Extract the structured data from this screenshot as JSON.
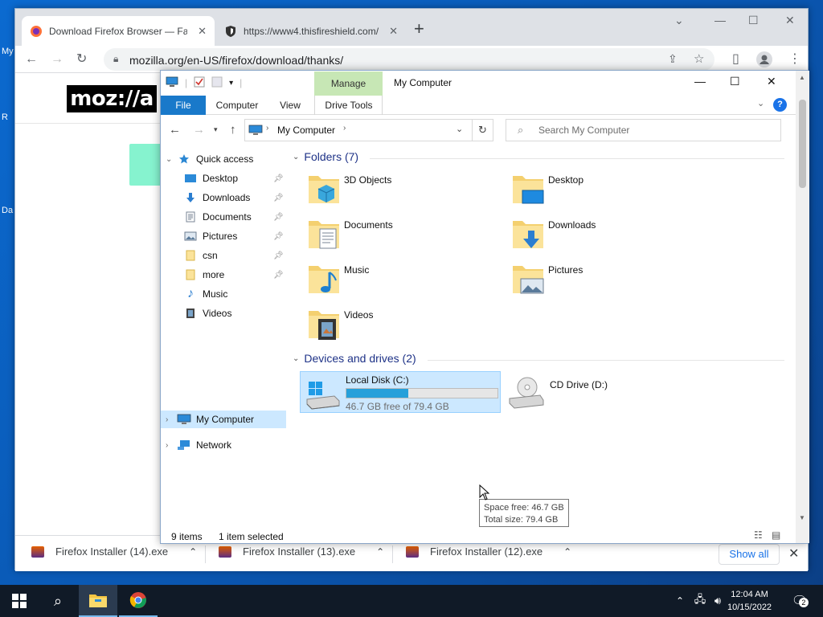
{
  "desktop": {
    "labels": [
      "My",
      "Re",
      "Da"
    ]
  },
  "chrome": {
    "tabs": [
      {
        "title": "Download Firefox Browser — Fast",
        "icon": "firefox-icon"
      },
      {
        "title": "https://www4.thisfireshield.com/",
        "icon": "shield-icon"
      }
    ],
    "new_tab": "+",
    "url": "mozilla.org/en-US/firefox/download/thanks/",
    "logo": "moz://a"
  },
  "downloads": {
    "items": [
      "Firefox Installer (14).exe",
      "Firefox Installer (13).exe",
      "Firefox Installer (12).exe"
    ],
    "show_all": "Show all"
  },
  "explorer": {
    "title": "My Computer",
    "manage_label": "Manage",
    "ribbon_tabs": {
      "file": "File",
      "computer": "Computer",
      "view": "View",
      "drive_tools": "Drive Tools"
    },
    "help": "?",
    "address": "My Computer",
    "search_placeholder": "Search My Computer",
    "nav": {
      "quick_access": "Quick access",
      "items": [
        "Desktop",
        "Downloads",
        "Documents",
        "Pictures",
        "csn",
        "more",
        "Music",
        "Videos"
      ],
      "my_computer": "My Computer",
      "network": "Network"
    },
    "folders_header": "Folders (7)",
    "folders": [
      "3D Objects",
      "Desktop",
      "Documents",
      "Downloads",
      "Music",
      "Pictures",
      "Videos"
    ],
    "drives_header": "Devices and drives (2)",
    "drives": [
      {
        "name": "Local Disk (C:)",
        "free": "46.7 GB free of 79.4 GB",
        "used_fraction": 0.412
      },
      {
        "name": "CD Drive (D:)"
      }
    ],
    "tooltip": {
      "line1": "Space free: 46.7 GB",
      "line2": "Total size: 79.4 GB"
    },
    "status": {
      "items": "9 items",
      "selected": "1 item selected"
    }
  },
  "taskbar": {
    "time": "12:04 AM",
    "date": "10/15/2022",
    "notifications": "2"
  }
}
